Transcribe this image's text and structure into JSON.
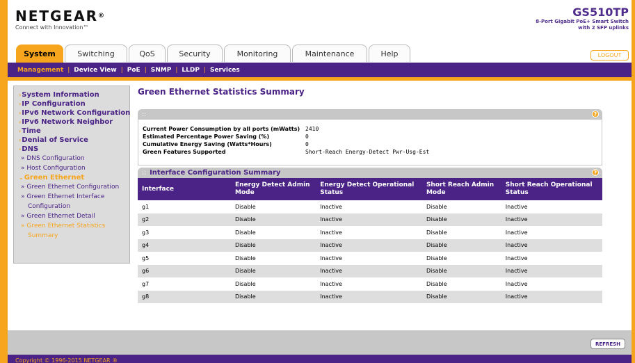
{
  "header": {
    "logo_name": "NETGEAR",
    "logo_mark": "®",
    "tagline": "Connect with Innovation™",
    "model": "GS510TP",
    "model_desc_1": "8-Port Gigabit PoE+ Smart Switch",
    "model_desc_2": "with 2 SFP uplinks",
    "logout": "LOGOUT"
  },
  "tabs": [
    "System",
    "Switching",
    "QoS",
    "Security",
    "Monitoring",
    "Maintenance",
    "Help"
  ],
  "subnav": [
    "Management",
    "Device View",
    "PoE",
    "SNMP",
    "LLDP",
    "Services"
  ],
  "sidebar": {
    "items": [
      {
        "label": "System Information"
      },
      {
        "label": "IP Configuration"
      },
      {
        "label": "IPv6 Network Configuration"
      },
      {
        "label": "IPv6 Network Neighbor"
      },
      {
        "label": "Time"
      },
      {
        "label": "Denial of Service"
      },
      {
        "label": "DNS"
      },
      {
        "label": "» DNS Configuration"
      },
      {
        "label": "» Host Configuration"
      },
      {
        "label": "Green Ethernet"
      },
      {
        "label": "» Green Ethernet Configuration"
      },
      {
        "label": "» Green Ethernet Interface"
      },
      {
        "label": "Configuration"
      },
      {
        "label": "» Green Ethernet Detail"
      },
      {
        "label": "» Green Ethernet Statistics"
      },
      {
        "label": "Summary"
      }
    ]
  },
  "main": {
    "title": "Green Ethernet Statistics Summary",
    "stats_bar_dots": "::",
    "stats": [
      {
        "label": "Current Power Consumption by all ports (mWatts)",
        "value": "2410"
      },
      {
        "label": "Estimated Percentage Power Saving (%)",
        "value": "0"
      },
      {
        "label": "Cumulative Energy Saving (Watts*Hours)",
        "value": "0"
      },
      {
        "label": "Green Features Supported",
        "value": "Short-Reach Energy-Detect Pwr-Usg-Est"
      }
    ],
    "interface_section_title": "Interface Configuration Summary",
    "columns": [
      "Interface",
      "Energy Detect Admin Mode",
      "Energy Detect Operational Status",
      "Short Reach Admin Mode",
      "Short Reach Operational Status"
    ],
    "rows": [
      [
        "g1",
        "Disable",
        "Inactive",
        "Disable",
        "Inactive"
      ],
      [
        "g2",
        "Disable",
        "Inactive",
        "Disable",
        "Inactive"
      ],
      [
        "g3",
        "Disable",
        "Inactive",
        "Disable",
        "Inactive"
      ],
      [
        "g4",
        "Disable",
        "Inactive",
        "Disable",
        "Inactive"
      ],
      [
        "g5",
        "Disable",
        "Inactive",
        "Disable",
        "Inactive"
      ],
      [
        "g6",
        "Disable",
        "Inactive",
        "Disable",
        "Inactive"
      ],
      [
        "g7",
        "Disable",
        "Inactive",
        "Disable",
        "Inactive"
      ],
      [
        "g8",
        "Disable",
        "Inactive",
        "Disable",
        "Inactive"
      ]
    ]
  },
  "help_glyph": "?",
  "footer": {
    "refresh": "REFRESH",
    "copyright": "Copyright © 1996-2015 NETGEAR ®"
  },
  "colors": {
    "accent": "#f7a51c",
    "brand": "#4b2386",
    "panel": "#c7c7c7"
  }
}
